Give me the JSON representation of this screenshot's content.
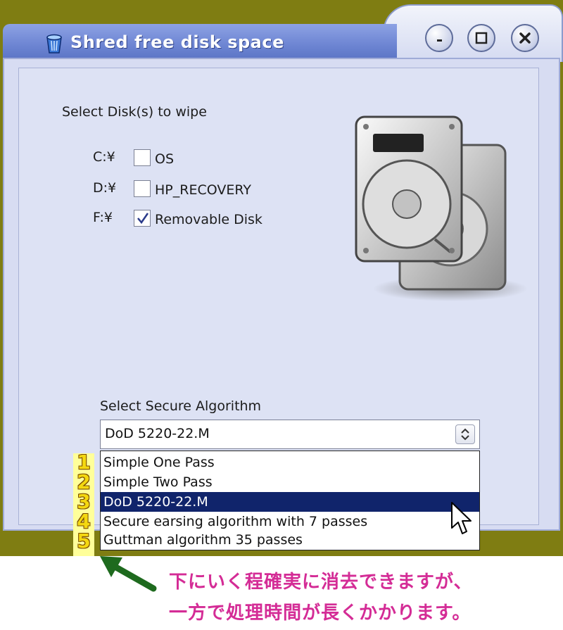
{
  "window": {
    "title": "Shred free disk space",
    "controls": [
      "minimize",
      "maximize",
      "close"
    ]
  },
  "disks": {
    "heading": "Select Disk(s) to wipe",
    "items": [
      {
        "drive": "C:¥",
        "label": "OS",
        "checked": false
      },
      {
        "drive": "D:¥",
        "label": "HP_RECOVERY",
        "checked": false
      },
      {
        "drive": "F:¥",
        "label": "Removable Disk",
        "checked": true
      }
    ]
  },
  "algorithm": {
    "heading": "Select Secure Algorithm",
    "selected": "DoD 5220-22.M",
    "options": [
      {
        "num": "1",
        "label": "Simple One Pass"
      },
      {
        "num": "2",
        "label": "Simple Two Pass"
      },
      {
        "num": "3",
        "label": "DoD 5220-22.M"
      },
      {
        "num": "4",
        "label": "Secure earsing algorithm with 7 passes"
      },
      {
        "num": "5",
        "label": "Guttman algorithm 35 passes"
      }
    ]
  },
  "annotation": {
    "line1": "下にいく程確実に消去できますが、",
    "line2": "一方で処理時間が長くかかります。"
  },
  "colors": {
    "background": "#7f7d12",
    "title_bar": "#6c84d2",
    "client": "#d7dcf2",
    "selection": "#10246b",
    "number_badge": "#f4d810",
    "caption": "#d42c96",
    "arrow": "#1e6a1e"
  },
  "icons": [
    "recycle-bin-icon",
    "minimize-icon",
    "maximize-icon",
    "close-icon",
    "hard-drives-icon",
    "checkmark-icon",
    "chevron-updown-icon",
    "mouse-cursor-icon",
    "arrow-icon"
  ]
}
